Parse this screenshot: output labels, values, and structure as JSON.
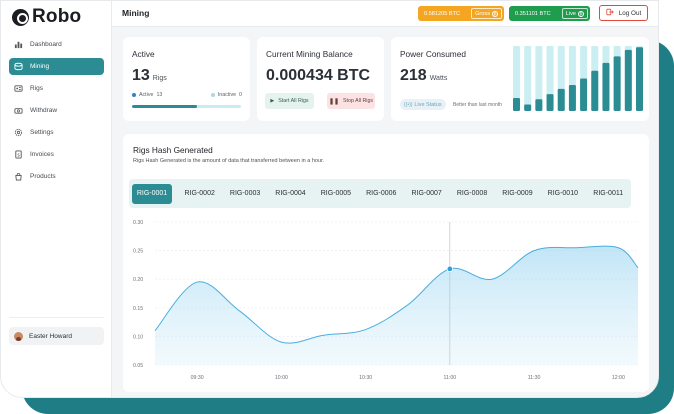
{
  "app": {
    "logo_text": "Robo"
  },
  "sidebar": {
    "items": [
      {
        "label": "Dashboard",
        "icon": "dashboard-icon",
        "active": false
      },
      {
        "label": "Mining",
        "icon": "mining-icon",
        "active": true
      },
      {
        "label": "Rigs",
        "icon": "rigs-icon",
        "active": false
      },
      {
        "label": "Withdraw",
        "icon": "withdraw-icon",
        "active": false
      },
      {
        "label": "Settings",
        "icon": "settings-icon",
        "active": false
      },
      {
        "label": "Invoices",
        "icon": "invoices-icon",
        "active": false
      },
      {
        "label": "Products",
        "icon": "products-icon",
        "active": false
      }
    ],
    "user": {
      "name": "Easter Howard"
    }
  },
  "header": {
    "title": "Mining",
    "gross": {
      "value": "0.581205 BTC",
      "label": "Gross"
    },
    "live": {
      "value": "0.351101 BTC",
      "label": "Live"
    },
    "logout_label": "Log Out"
  },
  "active_card": {
    "title": "Active",
    "count": "13",
    "unit": "Rigs",
    "active_label": "Active",
    "active_count": "13",
    "inactive_label": "Inactive",
    "inactive_count": "0",
    "progress": 0.6
  },
  "balance_card": {
    "title": "Current Mining Balance",
    "value": "0.000434 BTC",
    "start_label": "Start All Rigs",
    "stop_label": "Stop All Rigs"
  },
  "power_card": {
    "title": "Power Consumed",
    "value": "218",
    "unit": "Watts",
    "status_label": "Live Status",
    "comparison": "Better than last month",
    "bars": [
      0.2,
      0.1,
      0.18,
      0.26,
      0.34,
      0.4,
      0.5,
      0.62,
      0.74,
      0.84,
      0.94,
      0.98
    ]
  },
  "hash_card": {
    "title": "Rigs Hash Generated",
    "subtitle": "Rigs Hash Generated is the amount of data that transferred between in a hour.",
    "tabs": [
      "RIG-0001",
      "RIG-0002",
      "RIG-0003",
      "RIG-0004",
      "RIG-0005",
      "RIG-0006",
      "RIG-0007",
      "RIG-0008",
      "RIG-0009",
      "RIG-0010",
      "RIG-0011"
    ],
    "active_tab": 0
  },
  "chart_data": {
    "type": "area",
    "x": [
      "09:15",
      "09:30",
      "09:45",
      "10:00",
      "10:15",
      "10:30",
      "10:45",
      "11:00",
      "11:15",
      "11:30",
      "11:45",
      "12:00",
      "12:07"
    ],
    "y": [
      0.11,
      0.195,
      0.145,
      0.09,
      0.102,
      0.112,
      0.155,
      0.218,
      0.2,
      0.25,
      0.255,
      0.255,
      0.22
    ],
    "xticks": [
      "09:30",
      "10:00",
      "10:30",
      "11:00",
      "11:30",
      "12:00"
    ],
    "yticks": [
      "0.05",
      "0.10",
      "0.15",
      "0.20",
      "0.25",
      "0.30"
    ],
    "ylim": [
      0.05,
      0.3
    ],
    "highlight_index": 7,
    "grid": true,
    "color": "#4aaee0"
  },
  "colors": {
    "accent": "#2b8c93",
    "gross": "#f4a623",
    "live": "#1f9c4d",
    "logout_border": "#e2493d",
    "active_dot": "#2e86c1",
    "inactive_dot": "#a9dbe0"
  }
}
